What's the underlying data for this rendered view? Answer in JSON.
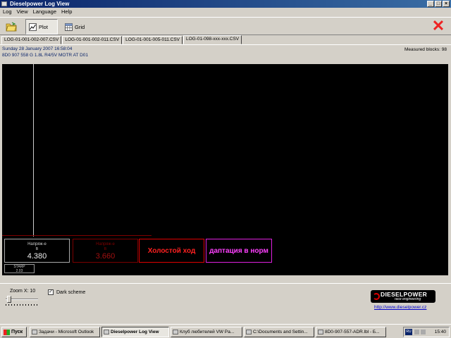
{
  "window": {
    "title": "Dieselpower Log View"
  },
  "menu": [
    "Log",
    "View",
    "Language",
    "Help"
  ],
  "toolbar": {
    "plot_label": "Plot",
    "grid_label": "Grid"
  },
  "tabs": [
    {
      "label": "LOG-01-001-002-007.CSV",
      "active": false
    },
    {
      "label": "LOG-01-001-002-011.CSV",
      "active": false
    },
    {
      "label": "LOG-01-001-005-011.CSV",
      "active": false
    },
    {
      "label": "LOG-01-098-xxx-xxx.CSV",
      "active": true
    }
  ],
  "info": {
    "date": "Sunday 28 January 2007 16:58:04",
    "ecu": "8D0 907 558 G  1.8L R4/5V  MOTR AT D01",
    "measured_blocks": "Measured blocks: 98"
  },
  "plot": {
    "boxes": [
      {
        "label": "Напряж-е",
        "unit": "В",
        "value": "4.380"
      },
      {
        "label": "Напряж-е",
        "unit": "В",
        "value": "3.660"
      },
      {
        "text": "Холостой ход"
      },
      {
        "text": "даптация в норм"
      }
    ],
    "small_box": {
      "line1": "STARP",
      "line2": "2.03"
    }
  },
  "controls": {
    "zoom_label": "Zoom X: 10",
    "dark_scheme_label": "Dark scheme",
    "dark_scheme_checked": true
  },
  "logo": {
    "brand": "DIESELPOWER",
    "tagline": "race engineering",
    "url": "http://www.dieselpower.cz"
  },
  "taskbar": {
    "start": "Пуск",
    "tasks": [
      {
        "label": "Задачи - Microsoft Outlook",
        "active": false
      },
      {
        "label": "Dieselpower Log View",
        "active": true
      },
      {
        "label": "Клуб любителей VW Pa...",
        "active": false
      },
      {
        "label": "C:\\Documents and Settin...",
        "active": false
      },
      {
        "label": "8D0-907-557-ADR.lbl - Б...",
        "active": false
      }
    ],
    "language": "RU",
    "clock": "15:40"
  }
}
